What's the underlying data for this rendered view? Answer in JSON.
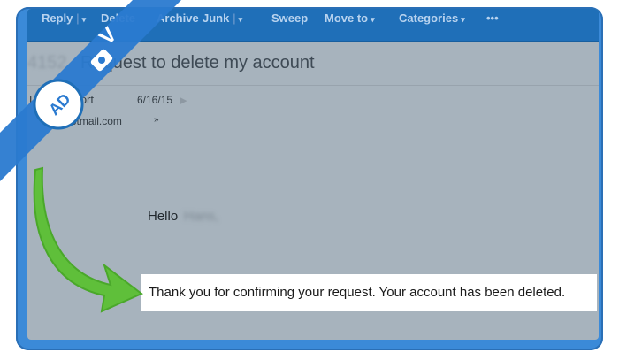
{
  "toolbar": {
    "items": [
      {
        "label": "Reply",
        "chevron": true
      },
      {
        "label": "Delete",
        "chevron": false
      },
      {
        "label": "Archive",
        "chevron": false
      },
      {
        "label": "Junk",
        "chevron": true
      },
      {
        "label": "Sweep",
        "chevron": false
      },
      {
        "label": "Move to",
        "chevron": true
      },
      {
        "label": "Categories",
        "chevron": true
      },
      {
        "label": "•••",
        "chevron": false
      }
    ]
  },
  "message": {
    "subject_id": "4152",
    "subject": "Request to delete my account",
    "sender": "Live Support",
    "date": "6/16/15",
    "email": "@hotmail.com",
    "greeting": "Hello",
    "greeting_name": "Hans,",
    "highlight_text": "Thank you for confirming your request. Your account has been deleted."
  },
  "logo": {
    "text": "AD",
    "letter": "V"
  },
  "colors": {
    "frame": "#3b8ad8",
    "toolbar": "#1f6fb8",
    "arrow": "#5fbf3a",
    "banner": "#2a7ad0"
  },
  "icons": {
    "flag": "flag-icon",
    "expand": "chevron-down-icon",
    "arrow": "curved-arrow-icon",
    "camera": "camera-icon"
  }
}
